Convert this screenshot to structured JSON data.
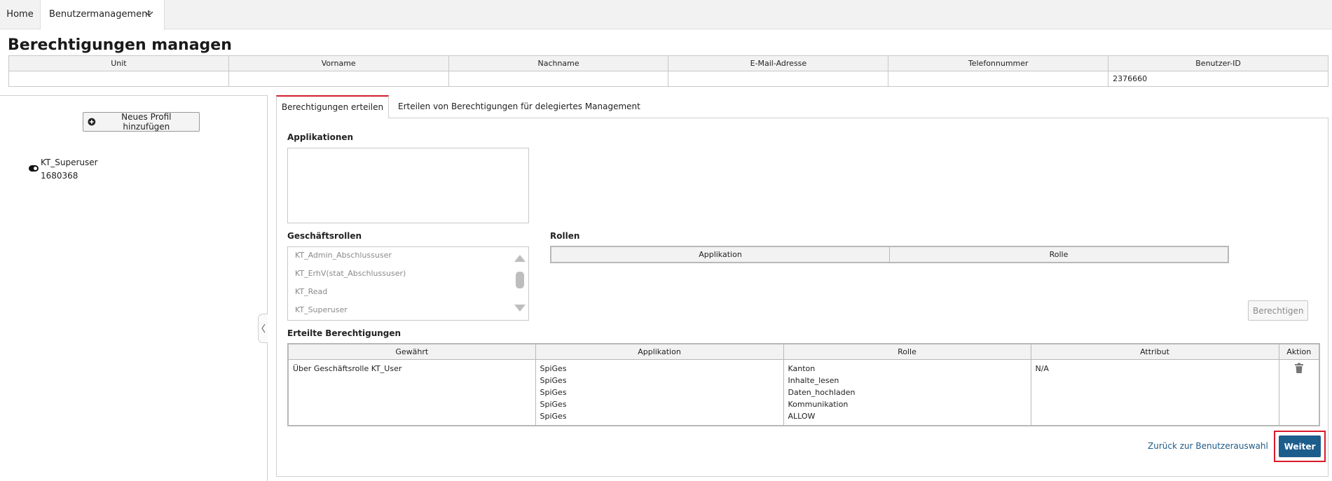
{
  "nav": {
    "home": "Home",
    "benutzermanagement": "Benutzermanagement"
  },
  "page": {
    "title": "Berechtigungen managen"
  },
  "user_table": {
    "headers": [
      "Unit",
      "Vorname",
      "Nachname",
      "E-Mail-Adresse",
      "Telefonnummer",
      "Benutzer-ID"
    ],
    "row": [
      "",
      "",
      "",
      "",
      "",
      "2376660"
    ]
  },
  "left_panel": {
    "add_profile_button": "Neues Profil hinzufügen",
    "profile": {
      "name": "KT_Superuser",
      "id": "1680368"
    }
  },
  "tabs": [
    {
      "label": "Berechtigungen erteilen",
      "active": true
    },
    {
      "label": "Erteilen von Berechtigungen für delegiertes Management",
      "active": false
    }
  ],
  "applikationen": {
    "label": "Applikationen"
  },
  "geschaeftsrollen": {
    "label": "Geschäftsrollen",
    "items": [
      "KT_Admin_Abschlussuser",
      "KT_ErhV(stat_Abschlussuser)",
      "KT_Read",
      "KT_Superuser"
    ]
  },
  "rollen": {
    "label": "Rollen",
    "headers": [
      "Applikation",
      "Rolle"
    ],
    "button": "Berechtigen"
  },
  "erteilte": {
    "label": "Erteilte Berechtigungen",
    "headers": [
      "Gewährt",
      "Applikation",
      "Rolle",
      "Attribut",
      "Aktion"
    ],
    "row": {
      "gewaehrt": "Über Geschäftsrolle KT_User",
      "applikation": [
        "SpiGes",
        "SpiGes",
        "SpiGes",
        "SpiGes",
        "SpiGes"
      ],
      "rolle": [
        "Kanton",
        "Inhalte_lesen",
        "Daten_hochladen",
        "Kommunikation",
        "ALLOW"
      ],
      "attribut": "N/A",
      "aktion_icon": "trash-icon"
    }
  },
  "footer": {
    "back_link": "Zurück zur Benutzerauswahl",
    "next_button": "Weiter"
  },
  "colors": {
    "accent_red": "#d01f2b",
    "primary_blue": "#1c5d8c",
    "link_blue": "#1e5a86"
  }
}
